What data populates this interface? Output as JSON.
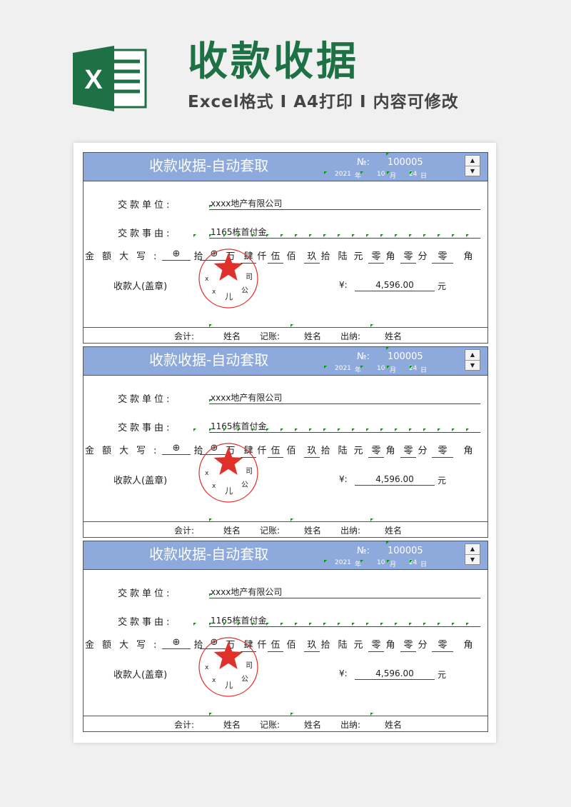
{
  "banner": {
    "title": "收款收据",
    "subtitle": "Excel格式 I A4打印 I 内容可修改",
    "logo_letter": "X"
  },
  "receipt": {
    "title": "收款收据-自动套取",
    "no_label": "№:",
    "no": "100005",
    "year": "2021",
    "year_unit": "年",
    "month": "10",
    "month_unit": "月",
    "day": "24",
    "day_unit": "日",
    "payer_label": "交款单位:",
    "payer": "xxxx地产有限公司",
    "reason_label": "交款事由:",
    "reason": "1165栋首付金",
    "amount_label": "金额大写:",
    "amount_cells": [
      "⊕",
      "拾",
      "⊕",
      "万",
      "肆",
      "仟",
      "伍",
      "佰",
      "玖",
      "拾",
      "陆",
      "元",
      "零",
      "角",
      "零",
      "分",
      "零",
      "角"
    ],
    "receiver_label": "收款人(盖章)",
    "currency": "¥:",
    "amount": "4,596.00",
    "amount_unit": "元",
    "accountant_label": "会计:",
    "accountant": "姓名",
    "bookkeeper_label": "记账:",
    "bookkeeper": "姓名",
    "cashier_label": "出纳:",
    "cashier": "姓名",
    "seal_chars": [
      "x",
      "x",
      "儿",
      "公",
      "司"
    ]
  },
  "colors": {
    "banner_green": "#1e7145",
    "header_blue": "#8ea9db",
    "seal_red": "#e0302a"
  }
}
